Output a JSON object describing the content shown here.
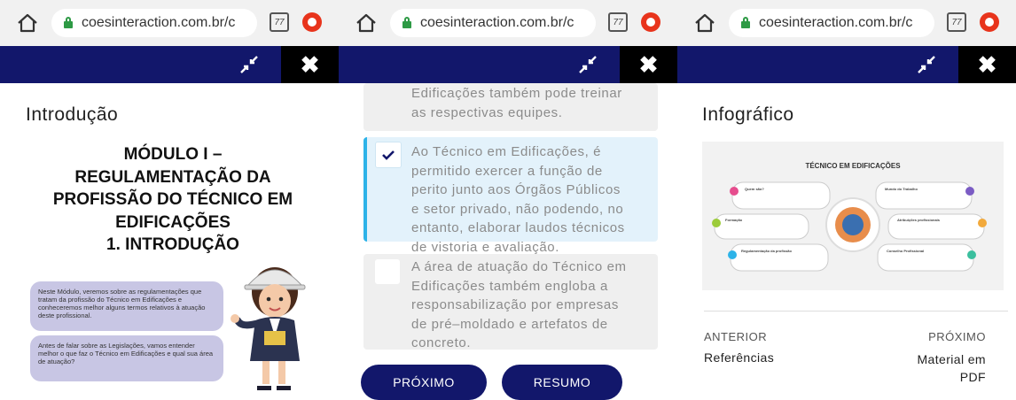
{
  "browser": {
    "url": "coesinteraction.com.br/c",
    "tab_count": "77"
  },
  "screen1": {
    "heading": "Introdução",
    "module_title_lines": [
      "MÓDULO I –",
      "REGULAMENTAÇÃO DA",
      "PROFISSÃO DO TÉCNICO EM",
      "EDIFICAÇÕES",
      "1. INTRODUÇÃO"
    ],
    "bubble1_text": "Neste Módulo, veremos sobre as regulamentações que tratam da profissão do Técnico em Edificações e conheceremos melhor alguns termos relativos à atuação deste profissional.",
    "bubble2_text": "Antes de falar sobre as Legislações, vamos entender melhor o que faz o Técnico em Edificações e qual sua área de atuação?"
  },
  "screen2": {
    "options": [
      {
        "text_lines": [
          "Edificações também pode treinar",
          "as respectivas equipes."
        ],
        "checked": false
      },
      {
        "text_lines": [
          "Ao Técnico em Edificações, é",
          "permitido exercer a função de",
          "perito junto aos Órgãos Públicos",
          "e setor privado, não podendo, no",
          "entanto, elaborar laudos técnicos",
          "de vistoria e avaliação."
        ],
        "checked": true
      },
      {
        "text_lines": [
          "A área de atuação do Técnico em",
          "Edificações também engloba a",
          "responsabilização por empresas",
          "de pré–moldado e artefatos de",
          "concreto."
        ],
        "checked": false
      }
    ],
    "next_label": "PRÓXIMO",
    "summary_label": "RESUMO"
  },
  "screen3": {
    "heading": "Infográfico",
    "infographic_title": "TÉCNICO EM EDIFICAÇÕES",
    "infographic_labels": [
      "Quem são?",
      "Formação",
      "Regulamentação da profissão",
      "Mundo do Trabalho",
      "Atribuições profissionais",
      "Conselho Profissional"
    ],
    "prev_label": "ANTERIOR",
    "prev_value": "Referências",
    "next_label": "PRÓXIMO",
    "next_value_lines": [
      "Material em",
      "PDF"
    ]
  },
  "colors": {
    "navbar": "#12176b",
    "accent_blue": "#2db3e8",
    "selected_bg": "#e3f2fb",
    "option_bg": "#efefef",
    "bubble": "#c8c6e4"
  }
}
